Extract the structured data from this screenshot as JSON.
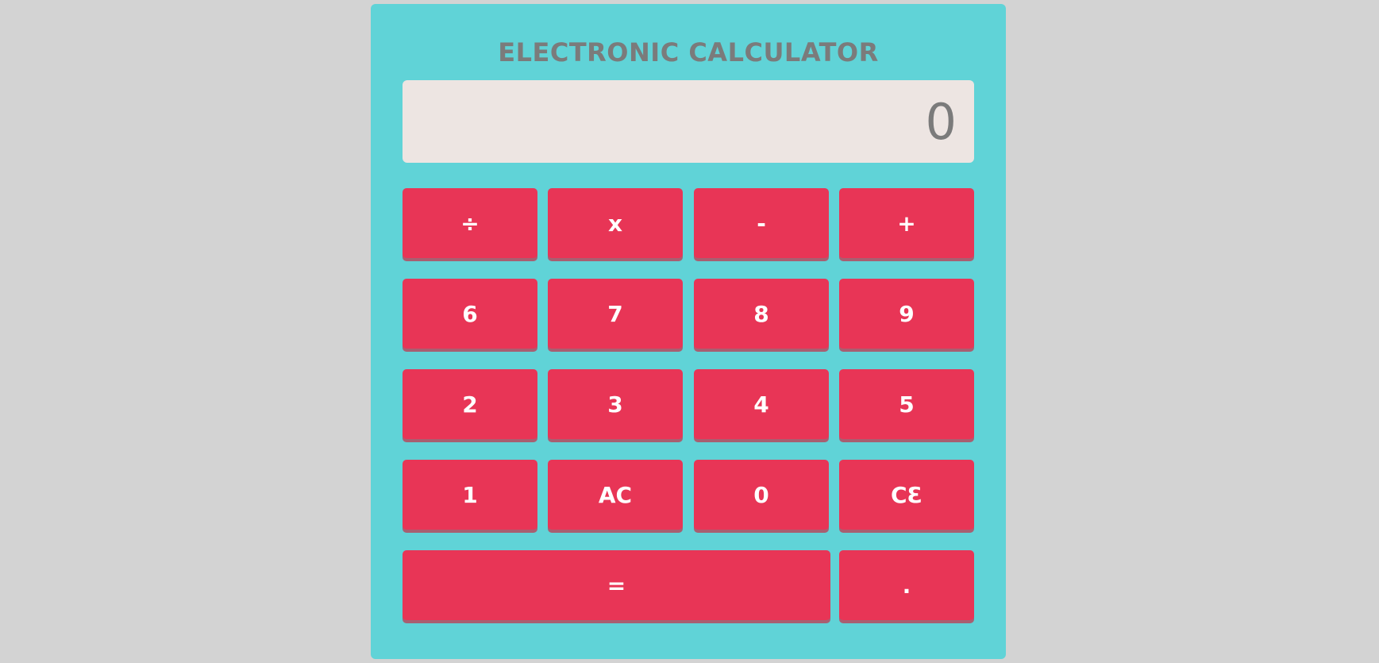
{
  "title": "ELECTRONIC CALCULATOR",
  "display": {
    "value": "0"
  },
  "keys": {
    "divide": "÷",
    "multiply": "x",
    "subtract": "-",
    "add": "+",
    "six": "6",
    "seven": "7",
    "eight": "8",
    "nine": "9",
    "two": "2",
    "three": "3",
    "four": "4",
    "five": "5",
    "one": "1",
    "all_clear": "AC",
    "zero": "0",
    "clear_entry": "CƐ",
    "equals": "=",
    "decimal": "."
  },
  "colors": {
    "page_background": "#d3d3d3",
    "calculator_body": "#60d3d7",
    "display_background": "#ede5e2",
    "text_gray": "#7b7b7b",
    "key_red": "#e83556",
    "key_shadow": "#a85f71",
    "key_text": "#ffffff"
  }
}
